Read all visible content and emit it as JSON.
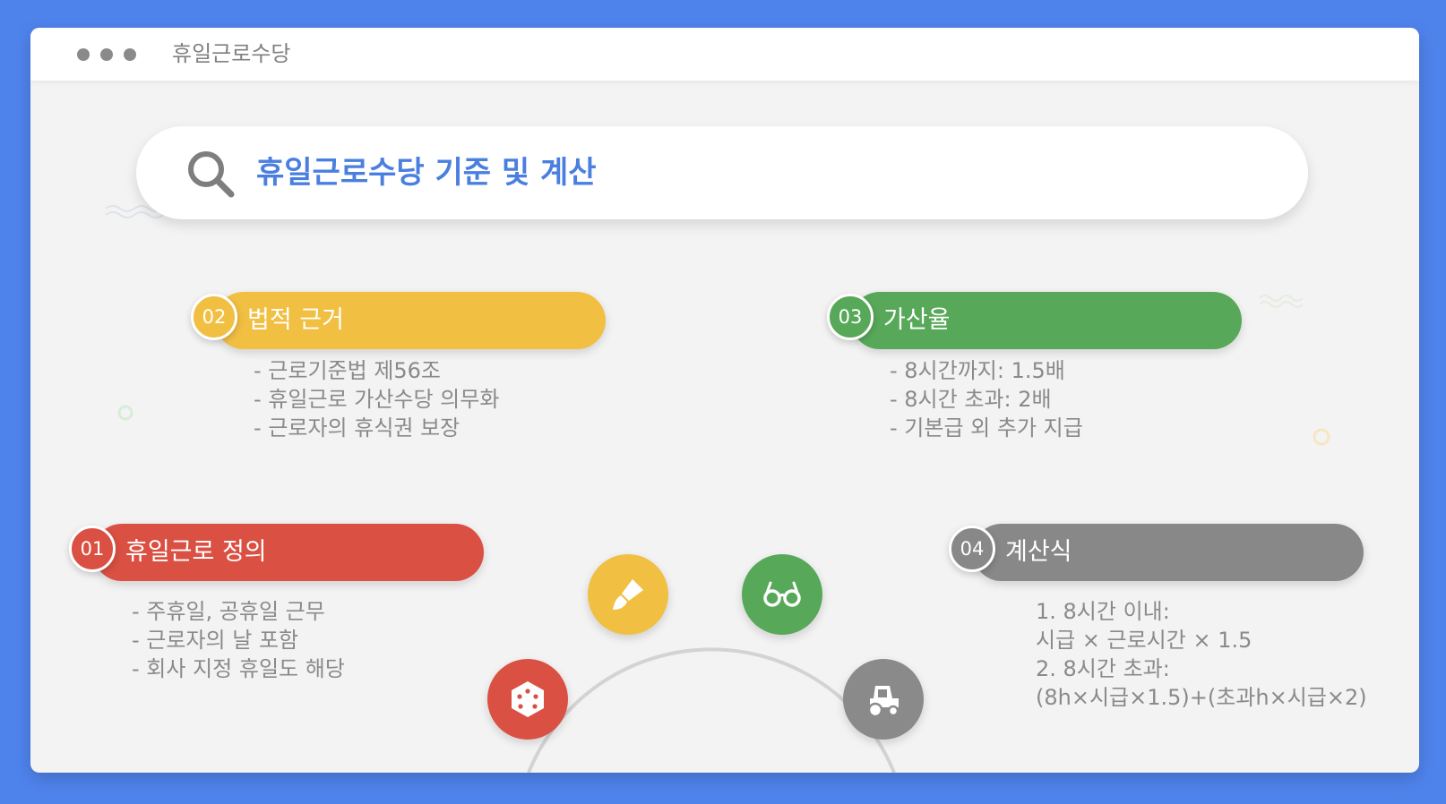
{
  "window": {
    "title": "휴일근로수당"
  },
  "search": {
    "title": "휴일근로수당 기준 및 계산"
  },
  "colors": {
    "red": "#da5043",
    "yellow": "#f1bf42",
    "green": "#58a85a",
    "gray": "#8a8a8a",
    "blue": "#4f83ec"
  },
  "sections": [
    {
      "number": "01",
      "title": "휴일근로 정의",
      "lines": [
        "- 주휴일, 공휴일 근무",
        "- 근로자의 날 포함",
        "- 회사 지정 휴일도 해당"
      ]
    },
    {
      "number": "02",
      "title": "법적 근거",
      "lines": [
        "- 근로기준법 제56조",
        "- 휴일근로 가산수당 의무화",
        "- 근로자의 휴식권 보장"
      ]
    },
    {
      "number": "03",
      "title": "가산율",
      "lines": [
        "- 8시간까지: 1.5배",
        "- 8시간 초과: 2배",
        "- 기본급 외 추가 지급"
      ]
    },
    {
      "number": "04",
      "title": "계산식",
      "lines": [
        "1. 8시간 이내:",
        "시급 × 근로시간 × 1.5",
        "2. 8시간 초과:",
        "(8h×시급×1.5)+(초과h×시급×2)"
      ]
    }
  ],
  "ring_icons": [
    "dice-icon",
    "brush-icon",
    "glasses-icon",
    "tractor-icon"
  ]
}
